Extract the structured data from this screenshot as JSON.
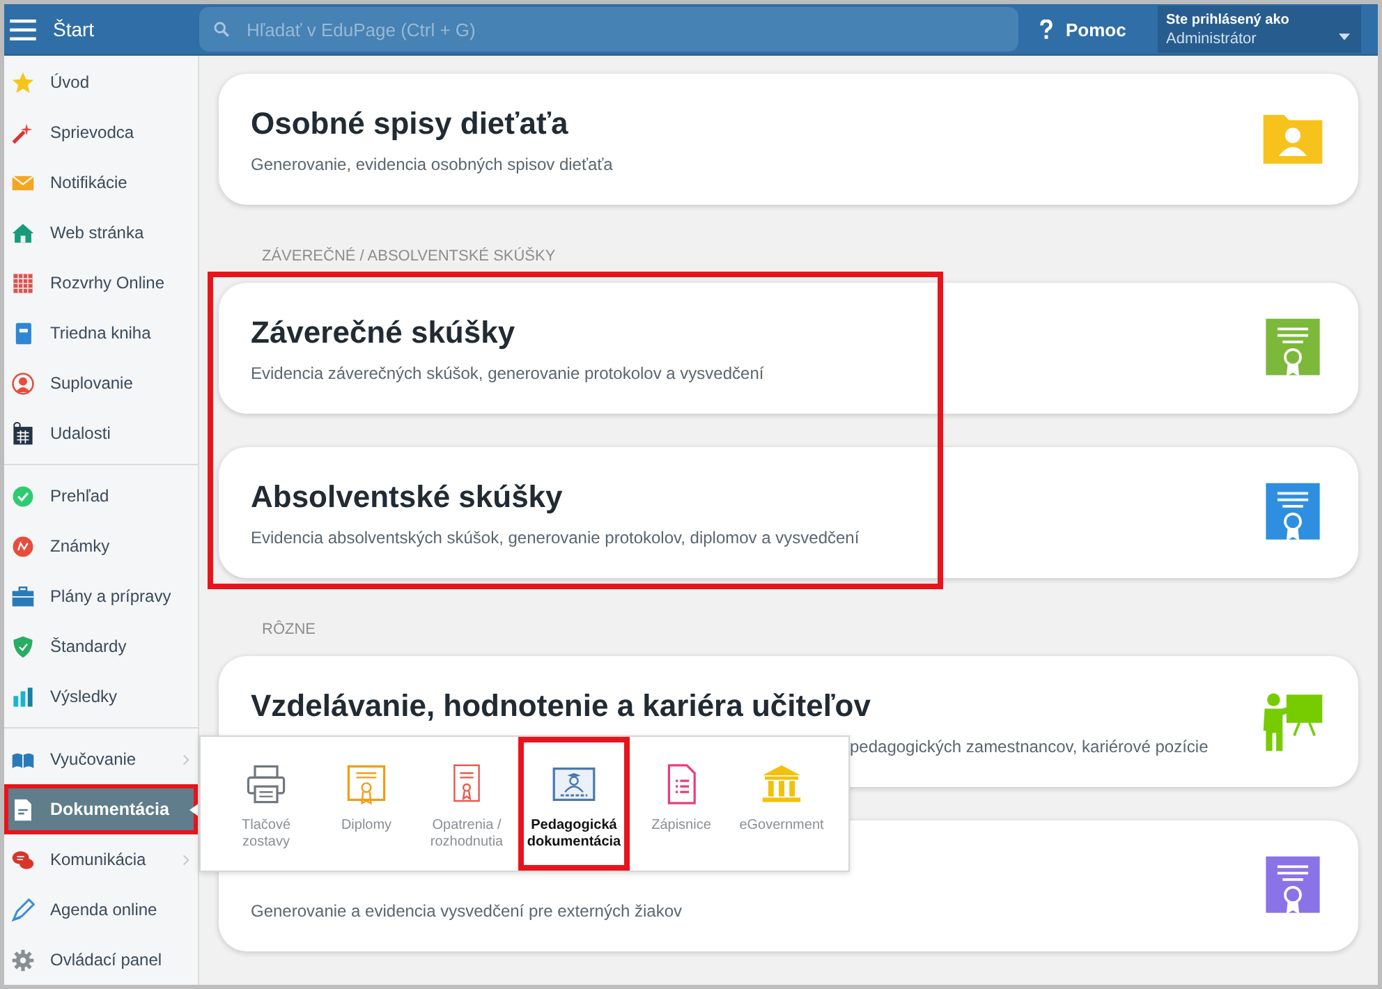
{
  "topbar": {
    "title": "Štart",
    "search": {
      "placeholder": "Hľadať v EduPage (Ctrl + G)"
    },
    "help": "Pomoc",
    "user": {
      "label": "Ste prihlásený ako",
      "name": "Administrátor"
    }
  },
  "sidebar": {
    "groups": [
      [
        {
          "label": "Úvod",
          "selected": false,
          "has_submenu": false,
          "highlighted": false
        },
        {
          "label": "Sprievodca",
          "selected": false,
          "has_submenu": false,
          "highlighted": false
        },
        {
          "label": "Notifikácie",
          "selected": false,
          "has_submenu": false,
          "highlighted": false
        },
        {
          "label": "Web stránka",
          "selected": false,
          "has_submenu": false,
          "highlighted": false
        },
        {
          "label": "Rozvrhy Online",
          "selected": false,
          "has_submenu": false,
          "highlighted": false
        },
        {
          "label": "Triedna kniha",
          "selected": false,
          "has_submenu": false,
          "highlighted": false
        },
        {
          "label": "Suplovanie",
          "selected": false,
          "has_submenu": false,
          "highlighted": false
        },
        {
          "label": "Udalosti",
          "selected": false,
          "has_submenu": false,
          "highlighted": false
        }
      ],
      [
        {
          "label": "Prehľad",
          "selected": false,
          "has_submenu": false,
          "highlighted": false
        },
        {
          "label": "Známky",
          "selected": false,
          "has_submenu": false,
          "highlighted": false
        },
        {
          "label": "Plány a prípravy",
          "selected": false,
          "has_submenu": false,
          "highlighted": false
        },
        {
          "label": "Štandardy",
          "selected": false,
          "has_submenu": false,
          "highlighted": false
        },
        {
          "label": "Výsledky",
          "selected": false,
          "has_submenu": false,
          "highlighted": false
        }
      ],
      [
        {
          "label": "Vyučovanie",
          "selected": false,
          "has_submenu": true,
          "highlighted": false
        },
        {
          "label": "Dokumentácia",
          "selected": true,
          "has_submenu": true,
          "highlighted": true
        },
        {
          "label": "Komunikácia",
          "selected": false,
          "has_submenu": true,
          "highlighted": false
        },
        {
          "label": "Agenda online",
          "selected": false,
          "has_submenu": false,
          "highlighted": false
        },
        {
          "label": "Ovládací panel",
          "selected": false,
          "has_submenu": false,
          "highlighted": false
        }
      ]
    ]
  },
  "sections": [
    {
      "cards": [
        {
          "title": "Osobné spisy dieťaťa",
          "subtitle": "Generovanie, evidencia osobných spisov dieťaťa",
          "covered": false
        }
      ],
      "highlighted": false
    },
    {
      "heading": "ZÁVEREČNÉ / ABSOLVENTSKÉ SKÚŠKY",
      "highlighted": true,
      "cards": [
        {
          "title": "Záverečné skúšky",
          "subtitle": "Evidencia záverečných skúšok, generovanie protokolov a vysvedčení",
          "covered": false
        },
        {
          "title": "Absolventské skúšky",
          "subtitle": "Evidencia absolventských skúšok, generovanie protokolov, diplomov a vysvedčení",
          "covered": false
        }
      ]
    },
    {
      "heading": "RÔZNE",
      "highlighted": false,
      "cards": [
        {
          "title": "Vzdelávanie, hodnotenie a kariéra učiteľov",
          "subtitle": "pedagogických zamestnancov, kariérové pozície",
          "covered": true
        },
        {
          "subtitle": "Generovanie a evidencia vysvedčení pre externých žiakov",
          "covered": false
        }
      ]
    }
  ],
  "submenu": [
    {
      "label": "Tlačové zostavy",
      "selected": false,
      "highlighted": false
    },
    {
      "label": "Diplomy",
      "selected": false,
      "highlighted": false
    },
    {
      "label": "Opatrenia / rozhodnutia",
      "selected": false,
      "highlighted": false
    },
    {
      "label": "Pedagogická dokumentácia",
      "selected": true,
      "highlighted": true
    },
    {
      "label": "Zápisnice",
      "selected": false,
      "highlighted": false
    },
    {
      "label": "eGovernment",
      "selected": false,
      "highlighted": false
    }
  ]
}
